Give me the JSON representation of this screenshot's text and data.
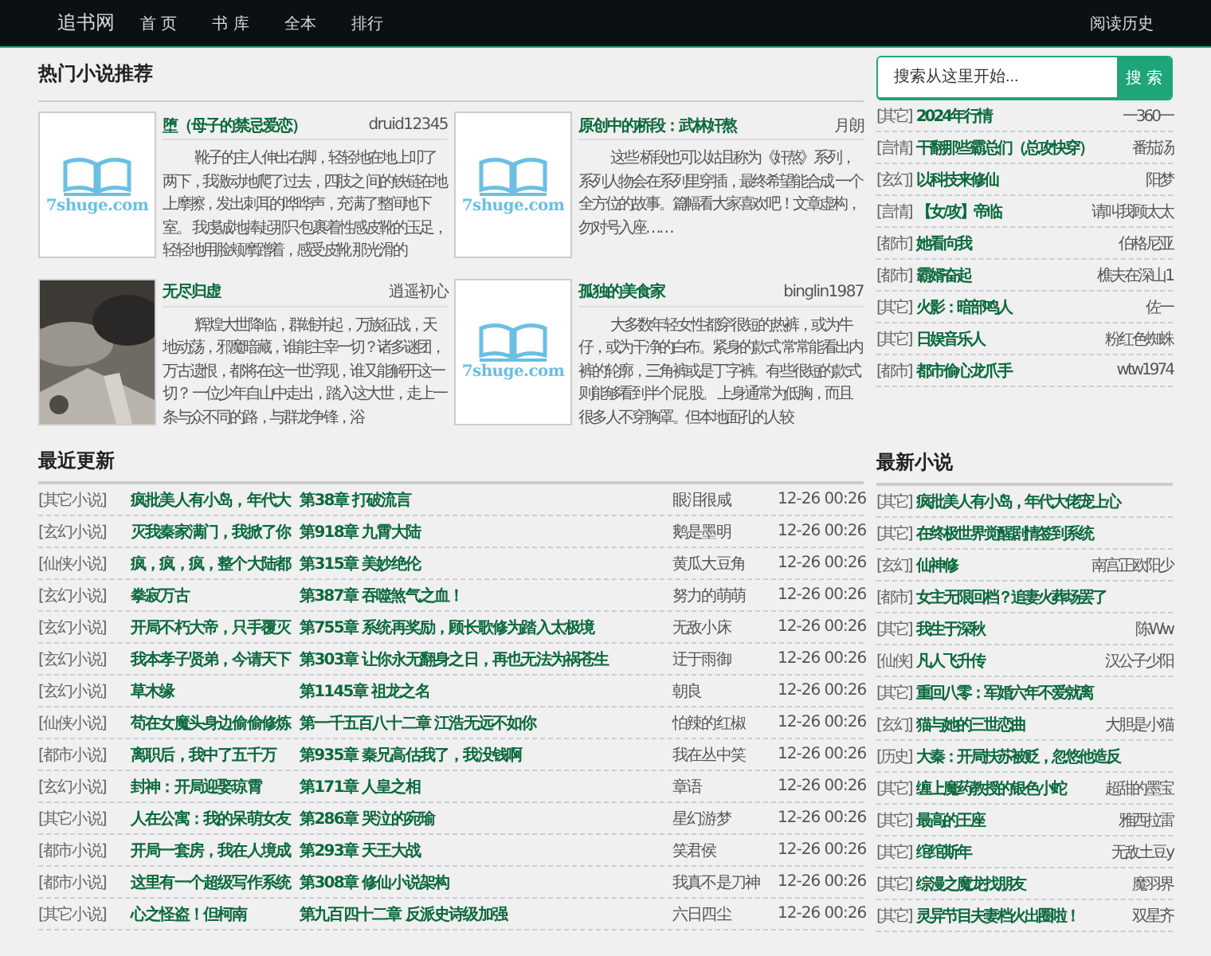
{
  "nav": {
    "logo": "追书网",
    "links": [
      "首 页",
      "书 库",
      "全本",
      "排行"
    ],
    "history": "阅读历史"
  },
  "hot": {
    "title": "热门小说推荐",
    "books": [
      {
        "cover": {
          "kind": "placeholder",
          "text": "7shuge.com"
        },
        "title": "堕（母子的禁忌爱恋）",
        "author": "druid12345",
        "intro": "靴子的主人伸出右脚，轻轻地在地上叩了两下，我激动地爬了过去，四肢之 间的铁链在地上摩擦，发出刺耳的哗哗声，充满了整间地下室。 我虔诚地捧起那只包裹着性感皮靴的玉足，轻轻地用脸颊摩蹭着，感受皮靴 那光滑的"
      },
      {
        "cover": {
          "kind": "placeholder",
          "text": "7shuge.com"
        },
        "title": "原创中的桥段：武林奸熬",
        "author": "月朗",
        "intro": "这些 桥段也可以姑且称为《奸熬》系列，系列人物会在系列里穿插，最终希望能合成 一个全方位的故事。篇幅看大家喜欢吧！文章虚构，勿对号入座……"
      },
      {
        "title": "无尽归虚",
        "author": "逍遥初心",
        "intro": "辉煌大世降临，群雄并起，万族征战，天地动荡，邪魔暗藏，谁能主宰一切？诸多谜团，万古遗恨，都将在这一世浮现，谁又能解开这一切？ 一位少年自山中走出，踏入这大世，走上一条与众不同的路，与群龙争锋，浴"
      },
      {
        "cover": {
          "kind": "placeholder",
          "text": "7shuge.com"
        },
        "title": "孤独的美食家",
        "author": "binglin1987",
        "intro": "大多数年轻女性都穿很短的热裤，或为牛仔，或为干净的白布。紧身的款式 常常能看出内裤的轮廓，三角裤或是丁字裤。有些很短的款式则能够看到半个屁 股。 上身通常为低胸，而且很多人不穿胸罩。但本地面孔的人较"
      }
    ]
  },
  "search": {
    "placeholder": "搜索从这里开始...",
    "button": "搜 索"
  },
  "hot_list": [
    {
      "category": "[其它]",
      "title": "2024年行情",
      "author": "一360一"
    },
    {
      "category": "[言情]",
      "title": "干翻那些霸总们（总攻快穿）",
      "author": "番茄汤"
    },
    {
      "category": "[玄幻]",
      "title": "以科技来修仙",
      "author": "阳梦"
    },
    {
      "category": "[言情]",
      "title": "【女/攻】帝临",
      "author": "请叫我顾太太"
    },
    {
      "category": "[都市]",
      "title": "她看向我",
      "author": "伯格尼亚"
    },
    {
      "category": "[都市]",
      "title": "霸婿奋起",
      "author": "樵夫在深山1"
    },
    {
      "category": "[其它]",
      "title": "火影：暗部鸣人",
      "author": "佐一"
    },
    {
      "category": "[其它]",
      "title": "日娱音乐人",
      "author": "粉红色蜘蛛"
    },
    {
      "category": "[都市]",
      "title": "都市偷心龙爪手",
      "author": "wtw1974"
    }
  ],
  "updates": {
    "title": "最近更新",
    "rows": [
      {
        "category": "[其它小说]",
        "title": "疯批美人有小岛，年代大",
        "chapter": "第38章 打破流言",
        "author": "眼泪很咸",
        "time": "12-26 00:26"
      },
      {
        "category": "[玄幻小说]",
        "title": "灭我秦家满门，我掀了你",
        "chapter": "第918章 九霄大陆",
        "author": "鹅是墨明",
        "time": "12-26 00:26"
      },
      {
        "category": "[仙侠小说]",
        "title": "疯，疯，疯，整个大陆都",
        "chapter": "第315章 美妙绝伦",
        "author": "黄瓜大豆角",
        "time": "12-26 00:26"
      },
      {
        "category": "[玄幻小说]",
        "title": "拳寂万古",
        "chapter": "第387章 吞噬煞气之血！",
        "author": "努力的萌萌",
        "time": "12-26 00:26"
      },
      {
        "category": "[玄幻小说]",
        "title": "开局不朽大帝，只手覆灭",
        "chapter": "第755章 系统再奖励，顾长歌修为踏入太极境",
        "author": "无敌小床",
        "time": "12-26 00:26"
      },
      {
        "category": "[玄幻小说]",
        "title": "我本孝子贤弟，今请天下",
        "chapter": "第303章 让你永无翻身之日，再也无法为祸苍生",
        "author": "迂于雨御",
        "time": "12-26 00:26"
      },
      {
        "category": "[玄幻小说]",
        "title": "草木缘",
        "chapter": "第1145章 祖龙之名",
        "author": "朝良",
        "time": "12-26 00:26"
      },
      {
        "category": "[仙侠小说]",
        "title": "苟在女魔头身边偷偷修炼",
        "chapter": "第一千五百八十二章 江浩无远不如你",
        "author": "怕辣的红椒",
        "time": "12-26 00:26"
      },
      {
        "category": "[都市小说]",
        "title": "离职后，我中了五千万",
        "chapter": "第935章 秦兄高估我了，我没钱啊",
        "author": "我在丛中笑",
        "time": "12-26 00:26"
      },
      {
        "category": "[玄幻小说]",
        "title": "封神：开局迎娶琼霄",
        "chapter": "第171章 人皇之相",
        "author": "章语",
        "time": "12-26 00:26"
      },
      {
        "category": "[其它小说]",
        "title": "人在公寓：我的呆萌女友",
        "chapter": "第286章 哭泣的宛瑜",
        "author": "星幻游梦",
        "time": "12-26 00:26"
      },
      {
        "category": "[都市小说]",
        "title": "开局一套房，我在人境成",
        "chapter": "第293章 天王大战",
        "author": "笑君侯",
        "time": "12-26 00:26"
      },
      {
        "category": "[都市小说]",
        "title": "这里有一个超级写作系统",
        "chapter": "第308章 修仙小说架构",
        "author": "我真不是刀神",
        "time": "12-26 00:26"
      },
      {
        "category": "[其它小说]",
        "title": "心之怪盗！但柯南",
        "chapter": "第九百四十二章 反派史诗级加强",
        "author": "六日四尘",
        "time": "12-26 00:26"
      }
    ]
  },
  "latest": {
    "title": "最新小说",
    "rows": [
      {
        "category": "[其它]",
        "title": "疯批美人有小岛，年代大佬宠上心"
      },
      {
        "category": "[其它]",
        "title": "在终极世界觉醒剧情签到系统"
      },
      {
        "category": "[玄幻]",
        "title": "仙神修",
        "author": "南宫正欧阳少"
      },
      {
        "category": "[都市]",
        "title": "女主无限回档？追妻火葬场罢了"
      },
      {
        "category": "[其它]",
        "title": "我生于深秋",
        "author": "陈Ww"
      },
      {
        "category": "[仙侠]",
        "title": "凡人飞升传",
        "author": "汉公子少阳"
      },
      {
        "category": "[其它]",
        "title": "重回八零：军婚六年不爱就离"
      },
      {
        "category": "[玄幻]",
        "title": "猫与她的三世恋曲",
        "author": "大胆是小猫"
      },
      {
        "category": "[历史]",
        "title": "大秦：开局扶苏被贬，忽悠他造反"
      },
      {
        "category": "[其它]",
        "title": "缠上魔药教授的银色小蛇",
        "author": "超甜的墨宝"
      },
      {
        "category": "[其它]",
        "title": "最高的王座",
        "author": "雅西拉雷"
      },
      {
        "category": "[其它]",
        "title": "绾绾斯年",
        "author": "无敌土豆y"
      },
      {
        "category": "[其它]",
        "title": "综漫之魔龙找朋友",
        "author": "魔羽界"
      },
      {
        "category": "[其它]",
        "title": "灵异节目夫妻档火出圈啦！",
        "author": "双星齐"
      }
    ]
  }
}
